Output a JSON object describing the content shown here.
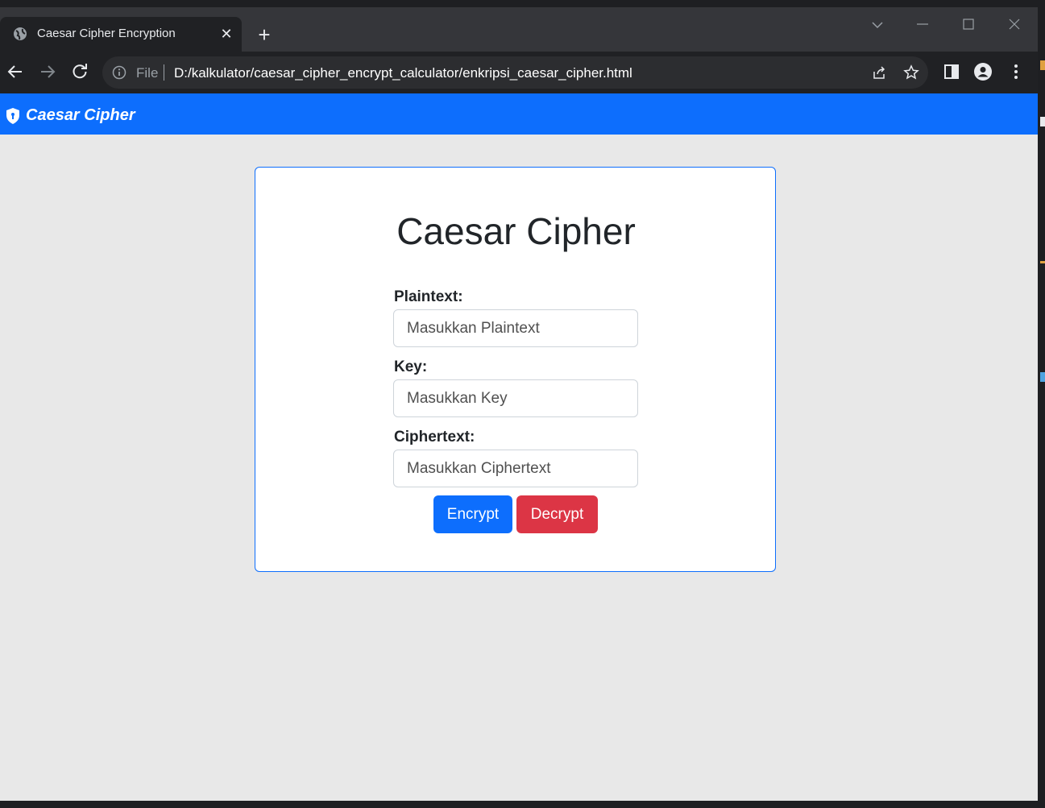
{
  "browser": {
    "tab": {
      "title": "Caesar Cipher Encryption"
    },
    "new_tab_label": "+",
    "close_label": "✕",
    "address": {
      "scheme_label": "File",
      "url": "D:/kalkulator/caesar_cipher_encrypt_calculator/enkripsi_caesar_cipher.html"
    }
  },
  "page": {
    "navbar": {
      "brand": "Caesar Cipher"
    },
    "card": {
      "title": "Caesar Cipher",
      "fields": [
        {
          "label": "Plaintext:",
          "placeholder": "Masukkan Plaintext",
          "value": ""
        },
        {
          "label": "Key:",
          "placeholder": "Masukkan Key",
          "value": ""
        },
        {
          "label": "Ciphertext:",
          "placeholder": "Masukkan Ciphertext",
          "value": ""
        }
      ],
      "buttons": {
        "encrypt": "Encrypt",
        "decrypt": "Decrypt"
      }
    }
  },
  "colors": {
    "primary": "#0d6efd",
    "danger": "#dc3545",
    "page_background": "#e8e8e8",
    "browser_chrome": "#202124"
  }
}
